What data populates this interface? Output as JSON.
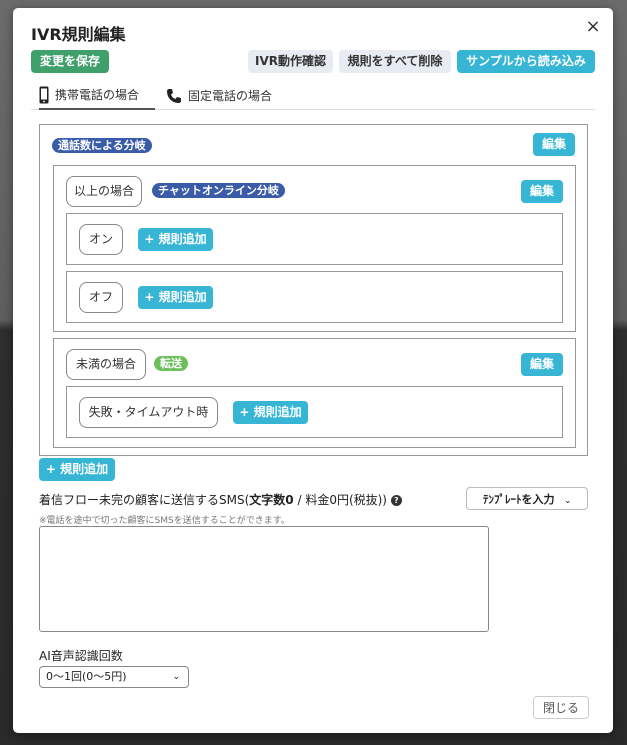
{
  "modal": {
    "title": "IVR規則編集",
    "close_label": "×"
  },
  "toolbar": {
    "save_label": "変更を保存",
    "check_label": "IVR動作確認",
    "delete_all_label": "規則をすべて削除",
    "load_sample_label": "サンプルから読み込み"
  },
  "tabs": [
    {
      "label": "携帯電話の場合",
      "icon": "mobile-phone-icon",
      "active": true
    },
    {
      "label": "固定電話の場合",
      "icon": "landline-phone-icon",
      "active": false
    }
  ],
  "rules": {
    "top_badge": "通話数による分岐",
    "edit_label": "編集",
    "add_rule_label": "+ 規則追加",
    "branches": [
      {
        "condition": "以上の場合",
        "badge": "チャットオンライン分岐",
        "edit_label": "編集",
        "options": [
          {
            "label": "オン",
            "add_label": "+ 規則追加"
          },
          {
            "label": "オフ",
            "add_label": "+ 規則追加"
          }
        ]
      },
      {
        "condition": "未満の場合",
        "badge": "転送",
        "edit_label": "編集",
        "options": [
          {
            "label": "失敗・タイムアウト時",
            "add_label": "+ 規則追加"
          }
        ]
      }
    ]
  },
  "sms": {
    "label_prefix": "着信フロー未完の顧客に送信するSMS(",
    "label_count": "文字数0",
    "label_suffix": " / 料金0円(税抜))",
    "help_icon": "?",
    "hint": "※電話を途中で切った顧客にSMSを送信することができます。",
    "template_label": "ﾃﾝﾌﾟﾚｰﾄを入力",
    "value": ""
  },
  "ai": {
    "label": "AI音声認識回数",
    "selected": "0〜1回(0〜5円)"
  },
  "footer": {
    "close_label": "閉じる"
  }
}
